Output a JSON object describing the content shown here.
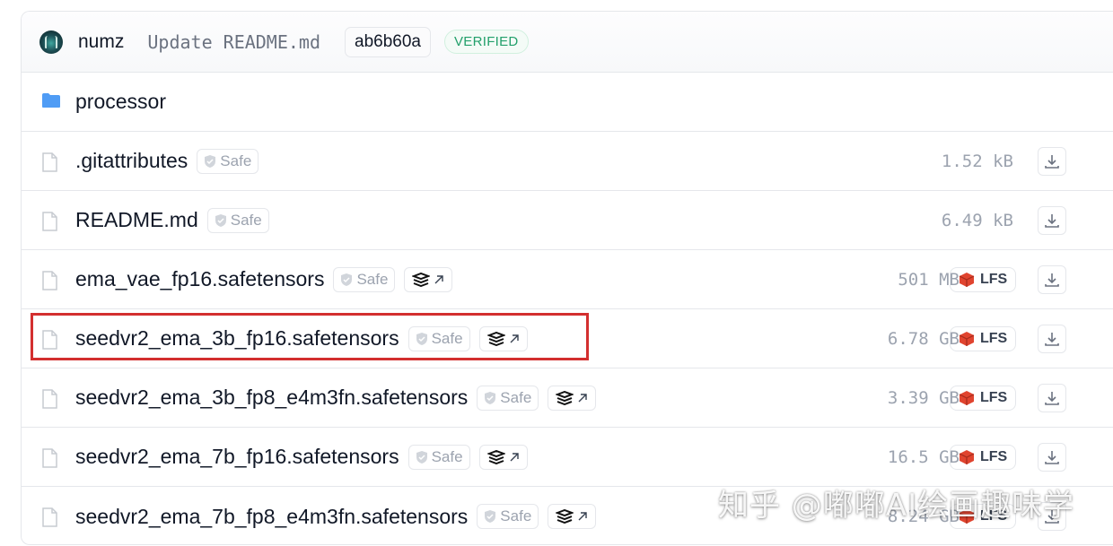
{
  "commit": {
    "author": "numz",
    "message": "Update README.md",
    "hash": "ab6b60a",
    "status": "VERIFIED"
  },
  "colors": {
    "folder": "#4f9cf5",
    "verified": "#22a06b",
    "lfs_icon": "#e0442f",
    "highlight": "#d32f2f"
  },
  "files": [
    {
      "name": "processor",
      "type": "folder",
      "icon": "folder-icon"
    },
    {
      "name": ".gitattributes",
      "type": "file",
      "safe": "Safe",
      "size": "1.52 kB",
      "xet": false,
      "lfs": ""
    },
    {
      "name": "README.md",
      "type": "file",
      "safe": "Safe",
      "size": "6.49 kB",
      "xet": false,
      "lfs": ""
    },
    {
      "name": "ema_vae_fp16.safetensors",
      "type": "file",
      "safe": "Safe",
      "size": "501 MB",
      "xet": true,
      "lfs": "LFS"
    },
    {
      "name": "seedvr2_ema_3b_fp16.safetensors",
      "type": "file",
      "safe": "Safe",
      "size": "6.78 GB",
      "xet": true,
      "lfs": "LFS",
      "highlighted": true
    },
    {
      "name": "seedvr2_ema_3b_fp8_e4m3fn.safetensors",
      "type": "file",
      "safe": "Safe",
      "size": "3.39 GB",
      "xet": true,
      "lfs": "LFS"
    },
    {
      "name": "seedvr2_ema_7b_fp16.safetensors",
      "type": "file",
      "safe": "Safe",
      "size": "16.5 GB",
      "xet": true,
      "lfs": "LFS"
    },
    {
      "name": "seedvr2_ema_7b_fp8_e4m3fn.safetensors",
      "type": "file",
      "safe": "Safe",
      "size": "8.24 GB",
      "xet": true,
      "lfs": "LFS"
    }
  ],
  "watermark": "知乎 @嘟嘟AI绘画趣味学"
}
